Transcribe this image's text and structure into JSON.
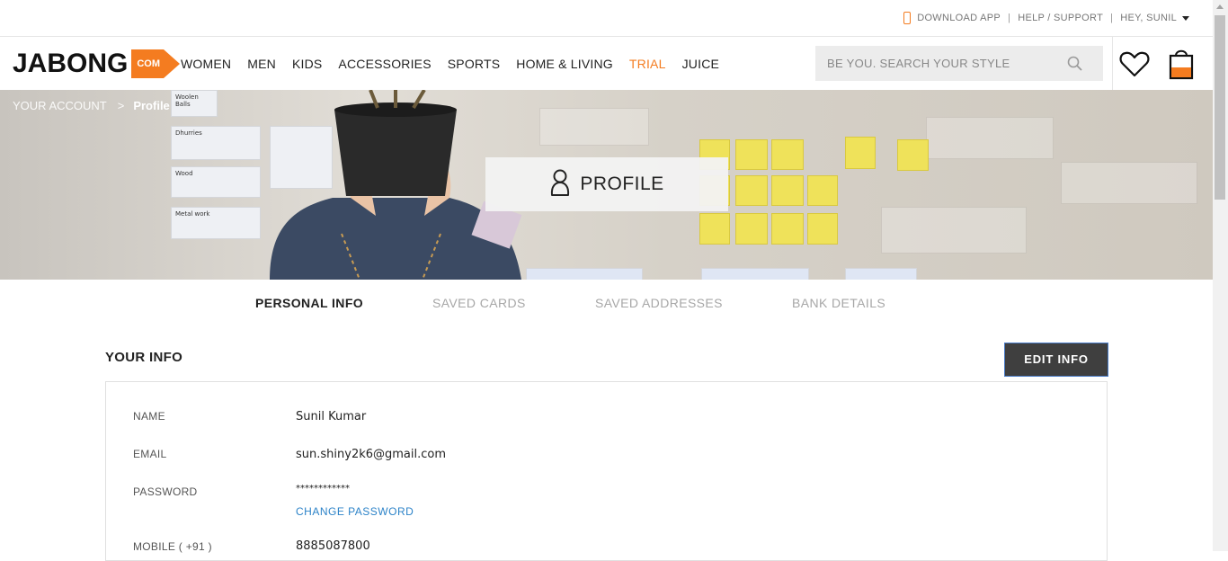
{
  "utility": {
    "download_app": "DOWNLOAD APP",
    "help_support": "HELP / SUPPORT",
    "greeting": "HEY, SUNIL"
  },
  "nav": {
    "logo_text": "JABONG",
    "logo_suffix": "COM",
    "items": [
      {
        "label": "WOMEN"
      },
      {
        "label": "MEN"
      },
      {
        "label": "KIDS"
      },
      {
        "label": "ACCESSORIES"
      },
      {
        "label": "SPORTS"
      },
      {
        "label": "HOME & LIVING"
      },
      {
        "label": "TRIAL"
      },
      {
        "label": "JUICE"
      }
    ],
    "search_placeholder": "BE YOU. SEARCH YOUR STYLE"
  },
  "hero": {
    "breadcrumb": {
      "parent": "YOUR ACCOUNT",
      "separator": ">",
      "current": "Profile"
    },
    "title": "PROFILE",
    "papers": [
      "Woolen Balls",
      "Dhurries",
      "Wood",
      "Metal work"
    ]
  },
  "tabs": [
    {
      "label": "PERSONAL INFO",
      "active": true
    },
    {
      "label": "SAVED CARDS",
      "active": false
    },
    {
      "label": "SAVED ADDRESSES",
      "active": false
    },
    {
      "label": "BANK DETAILS",
      "active": false
    }
  ],
  "info": {
    "title": "YOUR INFO",
    "edit_button": "EDIT INFO",
    "name_label": "NAME",
    "name_value": "Sunil Kumar",
    "email_label": "EMAIL",
    "email_value": "sun.shiny2k6@gmail.com",
    "password_label": "PASSWORD",
    "password_value": "************",
    "change_password": "CHANGE PASSWORD",
    "mobile_label": "MOBILE ( +91 )",
    "mobile_value": "8885087800"
  },
  "colors": {
    "accent": "#f47c20",
    "link": "#2c83c8",
    "button_bg": "#3f3f3f"
  }
}
